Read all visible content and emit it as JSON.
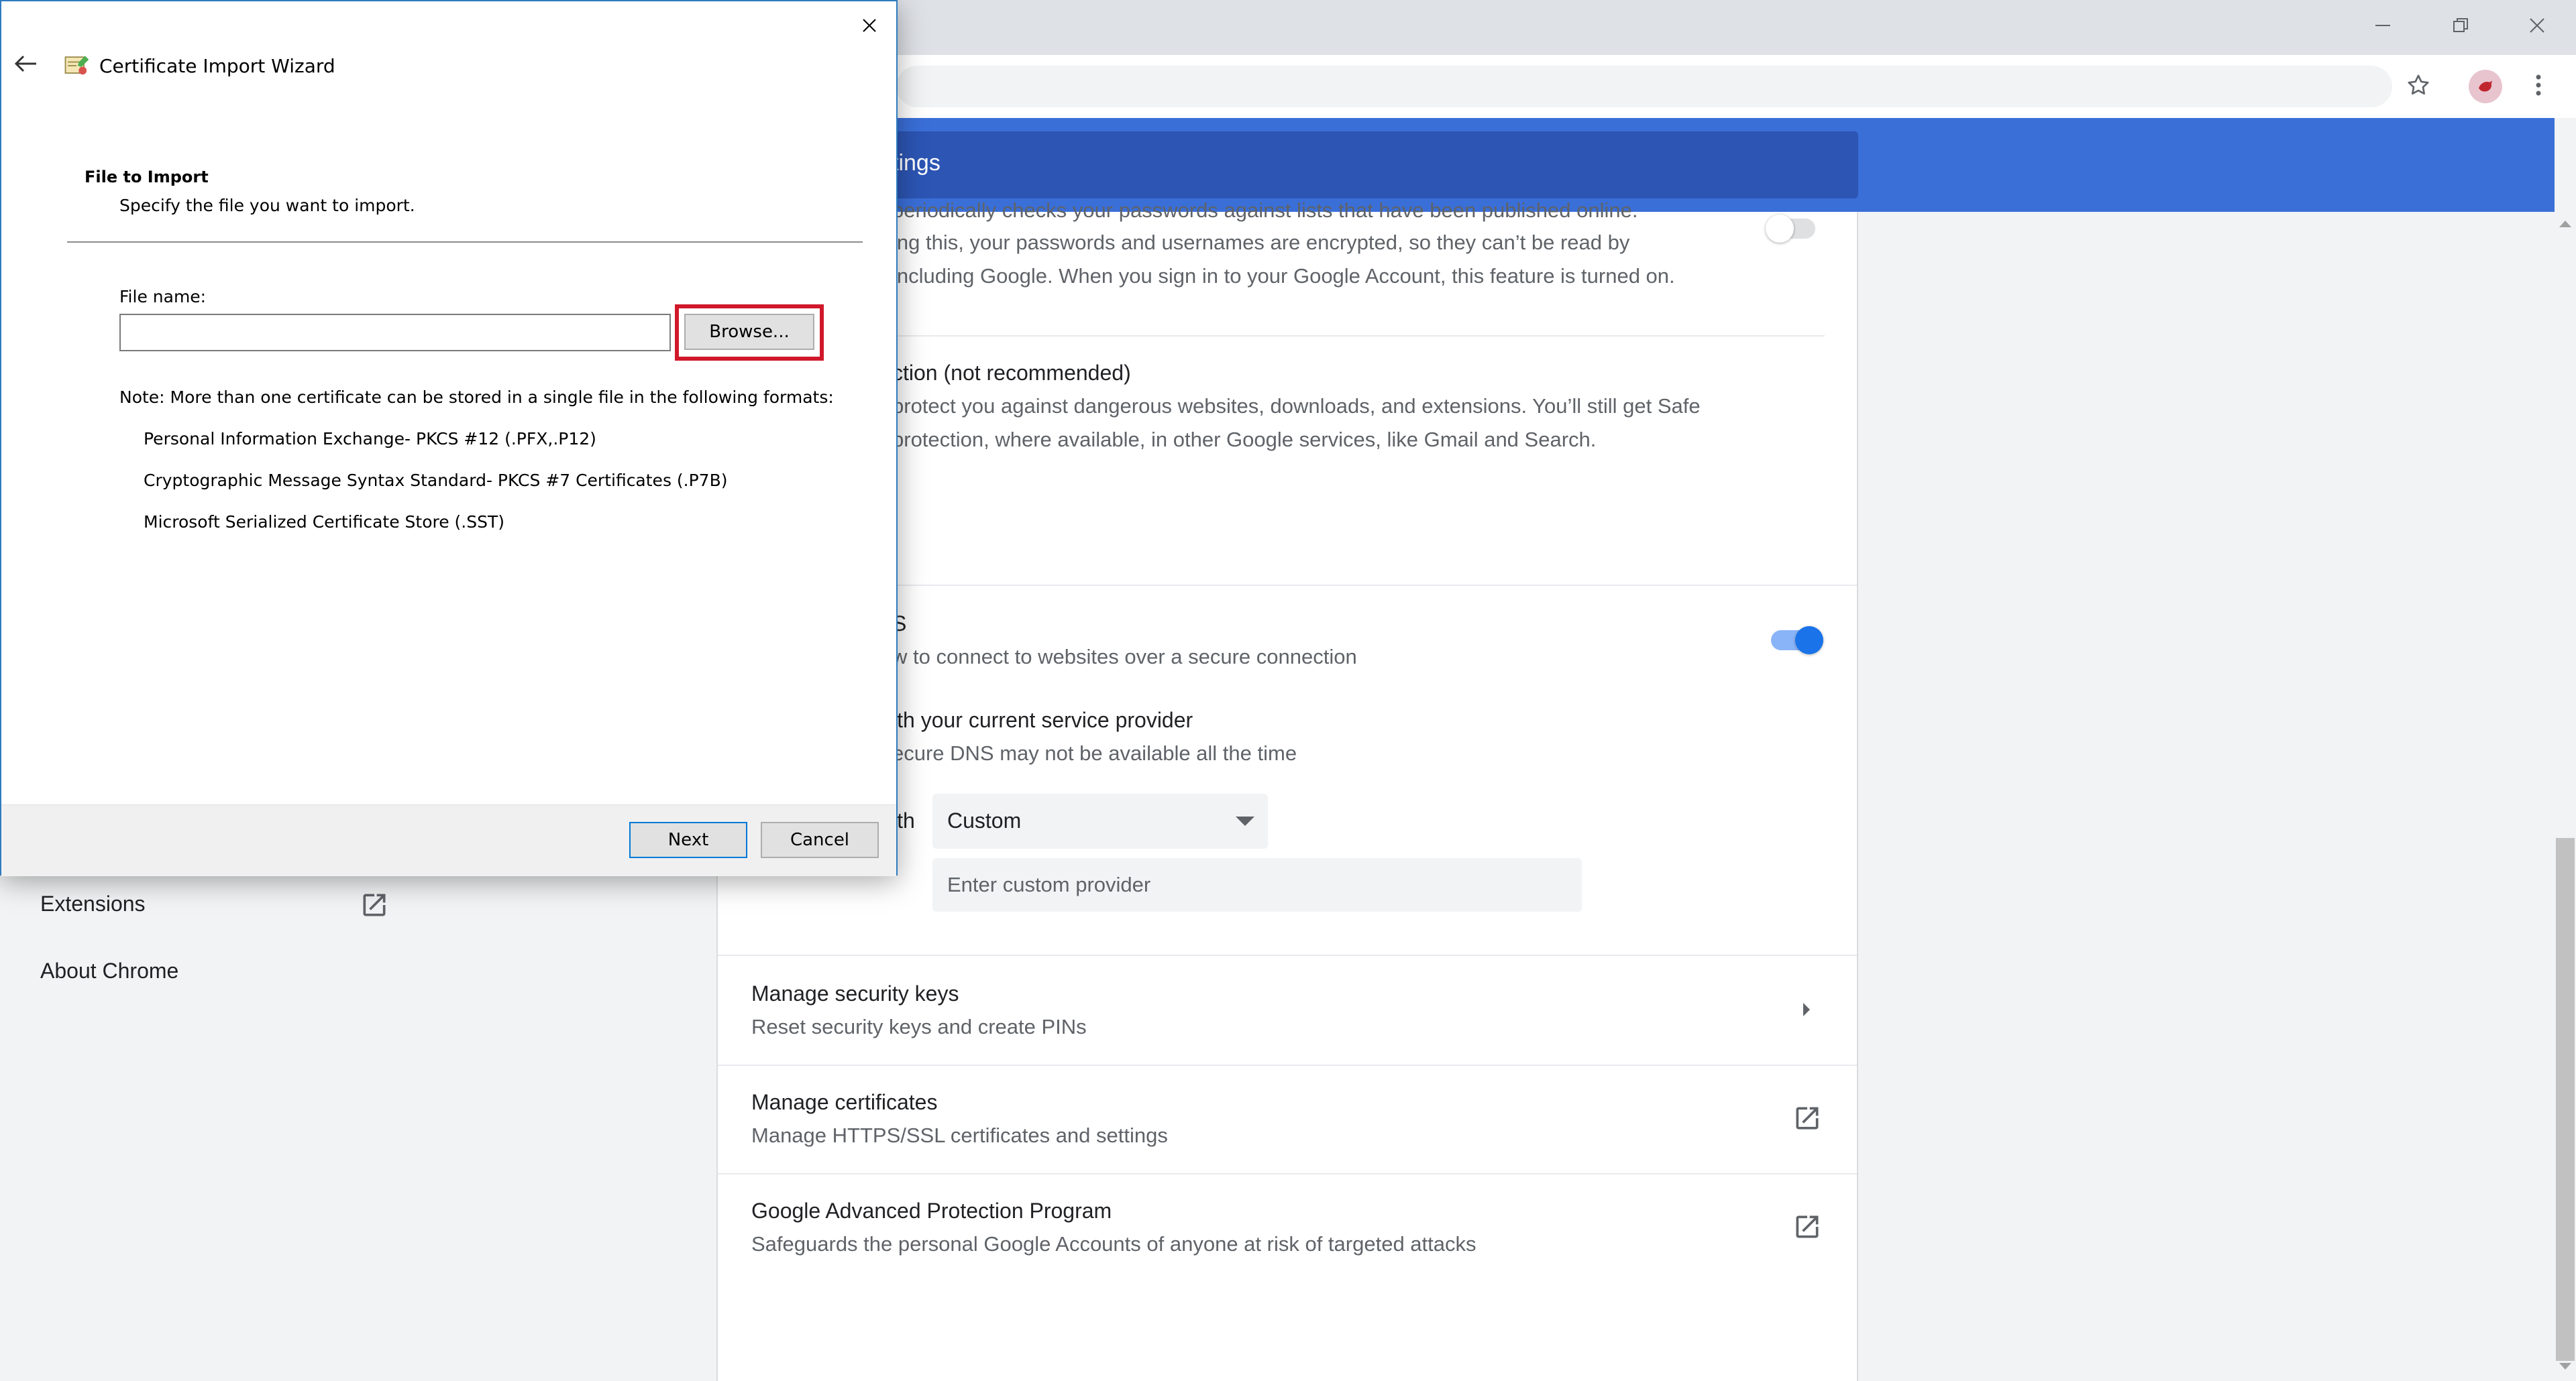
{
  "colors": {
    "accent": "#1a73e8",
    "header_blue": "#3a6fd8",
    "highlight_red": "#d0182a"
  },
  "chrome": {
    "window_controls": [
      "minimize-icon",
      "restore-icon",
      "close-icon"
    ],
    "toolbar_icons": [
      "star-icon",
      "profile-avatar",
      "more-vert-icon"
    ]
  },
  "settings": {
    "search_text": "tings",
    "safe_browsing": {
      "line1": "periodically checks your passwords against lists that have been published online.",
      "line2": "ing this, your passwords and usernames are encrypted, so they can’t be read by",
      "line3": "including Google. When you sign in to your Google Account, this feature is turned on."
    },
    "no_protection": {
      "title": "ction (not recommended)",
      "line1": "protect you against dangerous websites, downloads, and extensions. You’ll still get Safe",
      "line2": "protection, where available, in other Google services, like Gmail and Search."
    },
    "secure_dns": {
      "title": "S",
      "sub": "w to connect to websites over a secure connection",
      "option_title": "ith your current service provider",
      "option_sub": "ecure DNS may not be available all the time",
      "with_label": "ith",
      "select_value": "Custom",
      "provider_placeholder": "Enter custom provider"
    },
    "rows": [
      {
        "title": "Manage security keys",
        "sub": "Reset security keys and create PINs",
        "icon": "chevron-right-icon"
      },
      {
        "title": "Manage certificates",
        "sub": "Manage HTTPS/SSL certificates and settings",
        "icon": "external-link-icon"
      },
      {
        "title": "Google Advanced Protection Program",
        "sub": "Safeguards the personal Google Accounts of anyone at risk of targeted attacks",
        "icon": "external-link-icon"
      }
    ]
  },
  "sidebar": {
    "extensions": "Extensions",
    "about": "About Chrome"
  },
  "dialog": {
    "title": "Certificate Import Wizard",
    "heading": "File to Import",
    "subheading": "Specify the file you want to import.",
    "file_label": "File name:",
    "file_value": "",
    "browse_label": "Browse...",
    "note": "Note:  More than one certificate can be stored in a single file in the following formats:",
    "formats": [
      "Personal Information Exchange- PKCS #12 (.PFX,.P12)",
      "Cryptographic Message Syntax Standard- PKCS #7 Certificates (.P7B)",
      "Microsoft Serialized Certificate Store (.SST)"
    ],
    "next_label": "Next",
    "cancel_label": "Cancel"
  }
}
